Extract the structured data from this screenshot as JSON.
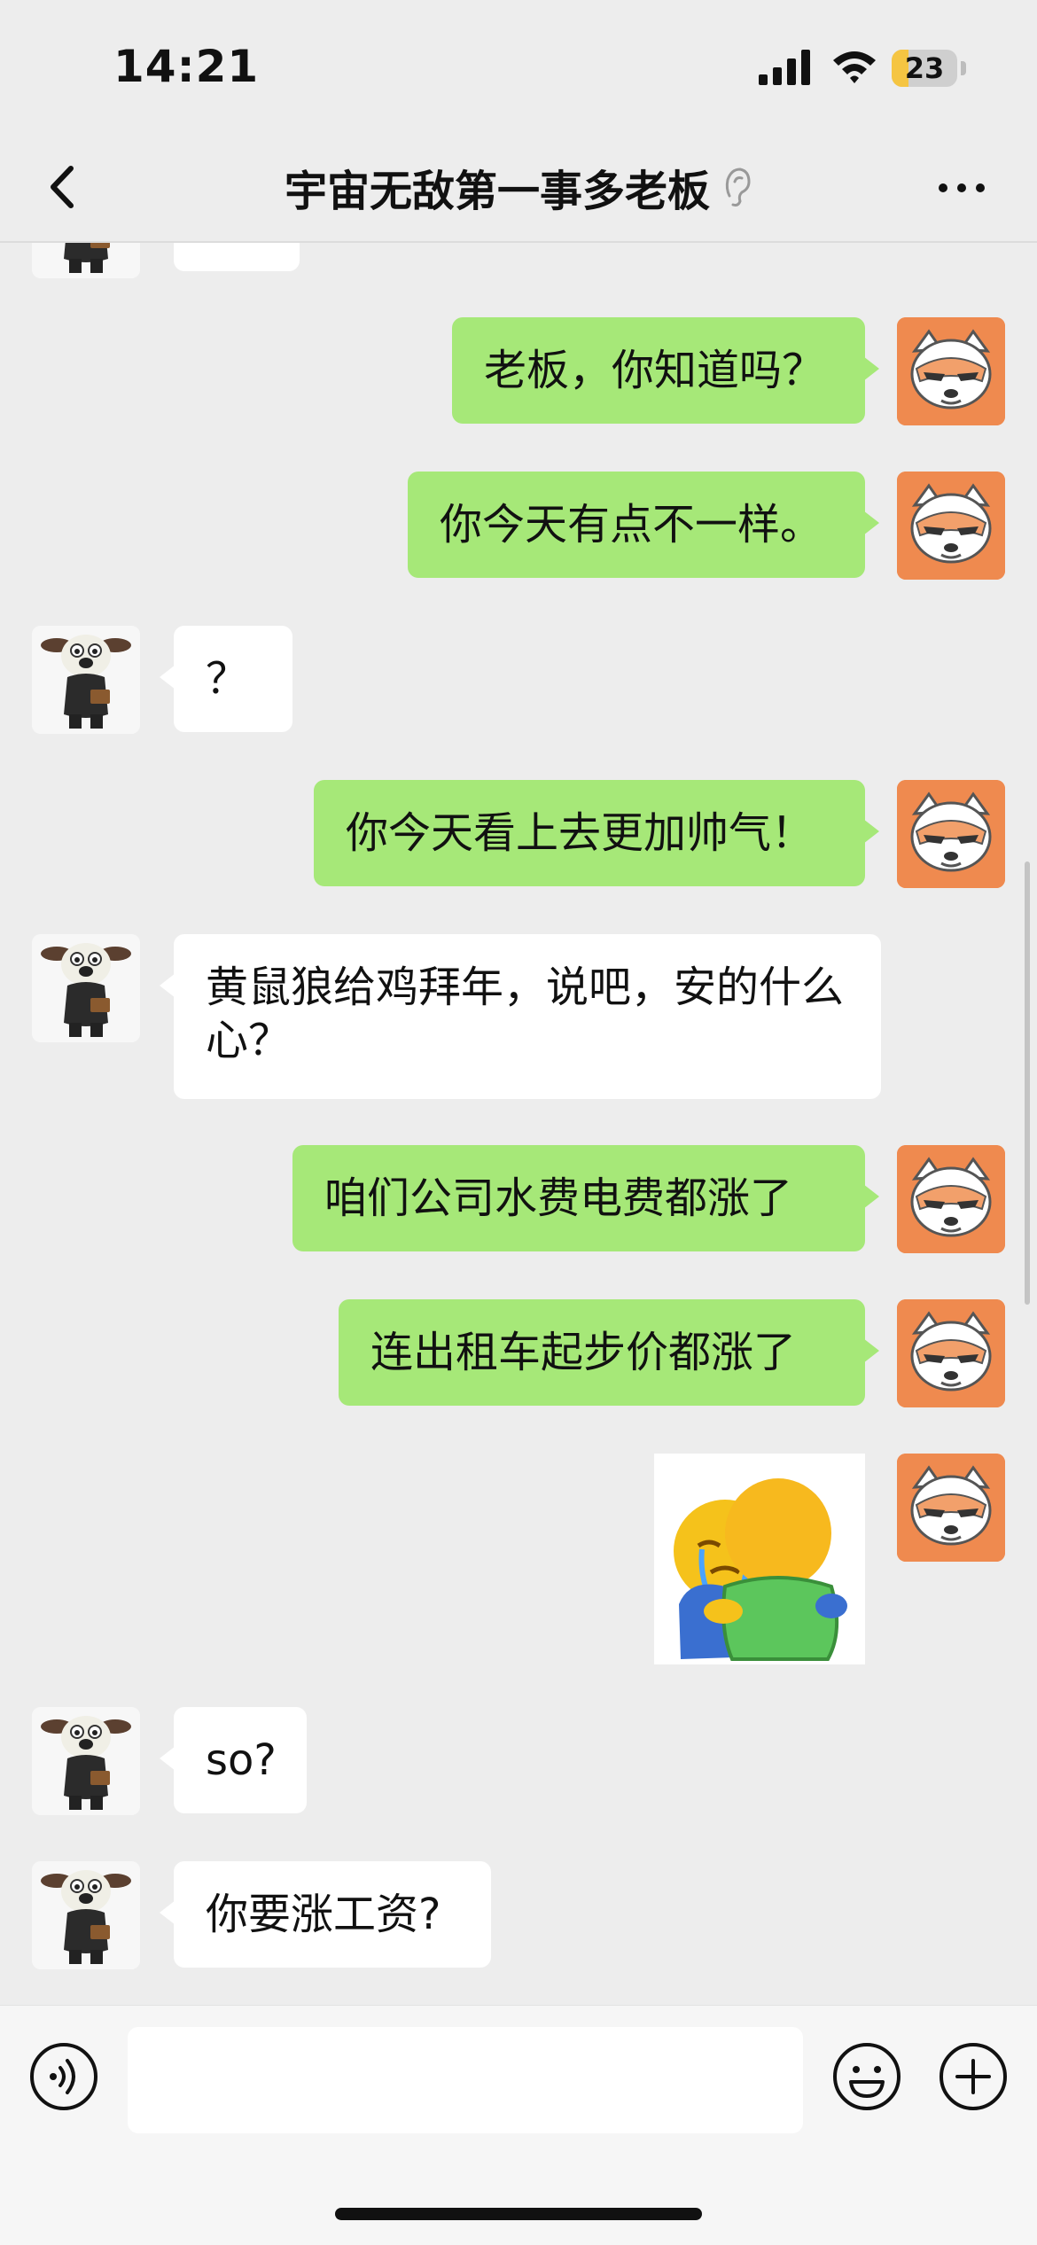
{
  "status_bar": {
    "time": "14:21",
    "battery_level": "23"
  },
  "nav": {
    "title": "宇宙无敌第一事多老板",
    "back_icon": "chevron-left-icon",
    "ear_icon": "ear-icon",
    "more_icon": "more-dots-icon"
  },
  "colors": {
    "background": "#ededed",
    "my_bubble": "#a6e878",
    "their_bubble": "#ffffff",
    "my_avatar_bg": "#ef8a4f"
  },
  "messages": [
    {
      "sender": "me",
      "text": "老板，你知道吗？"
    },
    {
      "sender": "me",
      "text": "你今天有点不一样。"
    },
    {
      "sender": "boss",
      "text": "？"
    },
    {
      "sender": "me",
      "text": "你今天看上去更加帅气！"
    },
    {
      "sender": "boss",
      "text": "黄鼠狼给鸡拜年，说吧，安的什么心？"
    },
    {
      "sender": "me",
      "text": "咱们公司水费电费都涨了"
    },
    {
      "sender": "me",
      "text": "连出租车起步价都涨了"
    },
    {
      "sender": "me",
      "sticker": "hugging-emoji-sticker"
    },
    {
      "sender": "boss",
      "text": "so?"
    },
    {
      "sender": "boss",
      "text": "你要涨工资?"
    }
  ],
  "input_bar": {
    "placeholder": "",
    "voice_icon": "voice-icon",
    "emoji_icon": "emoji-icon",
    "plus_icon": "plus-icon"
  }
}
